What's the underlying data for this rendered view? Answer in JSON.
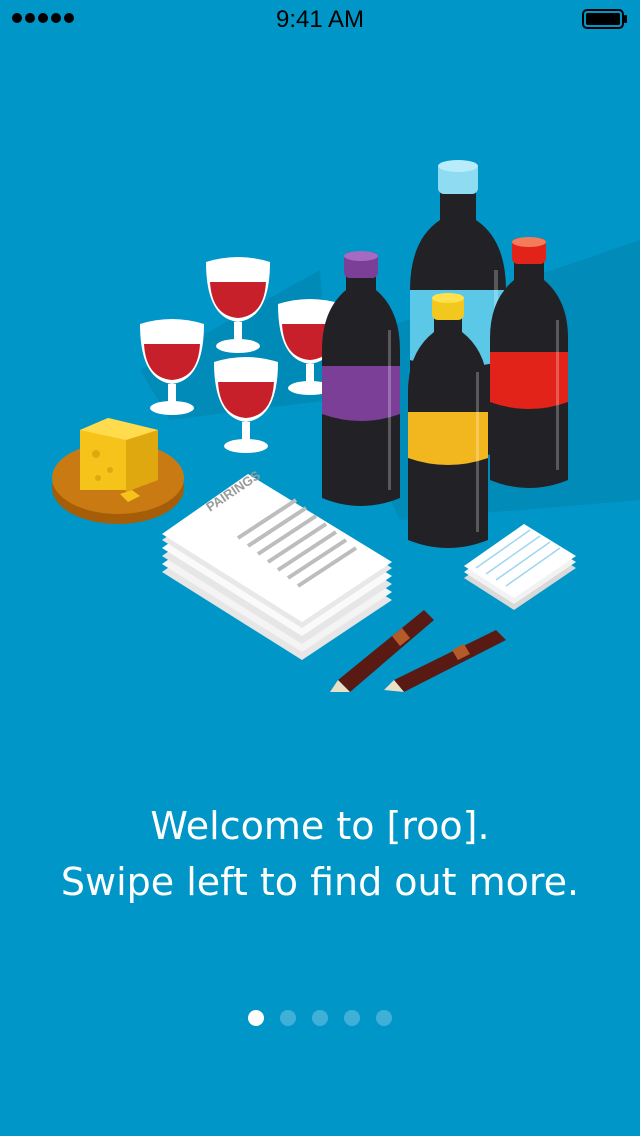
{
  "status_bar": {
    "time": "9:41 AM",
    "signal_bars": 5,
    "battery_level": 1.0,
    "signal_icon": "signal-dots-icon",
    "battery_icon": "battery-icon"
  },
  "illustration": {
    "name": "wine-pairing-illustration",
    "paper_label": "PAIRINGS"
  },
  "welcome": {
    "line1": "Welcome to [roo].",
    "line2": "Swipe left to find out more."
  },
  "pager": {
    "pages": 5,
    "active_index": 0
  },
  "colors": {
    "background": "#0097c8",
    "wine": "#c8202a",
    "bottle": "#222226",
    "label_purple": "#7b3f98",
    "label_blue": "#5ac8e6",
    "label_yellow": "#f2b71f",
    "label_red": "#e2231a",
    "cheese": "#f6c31b",
    "board": "#c97a12"
  }
}
